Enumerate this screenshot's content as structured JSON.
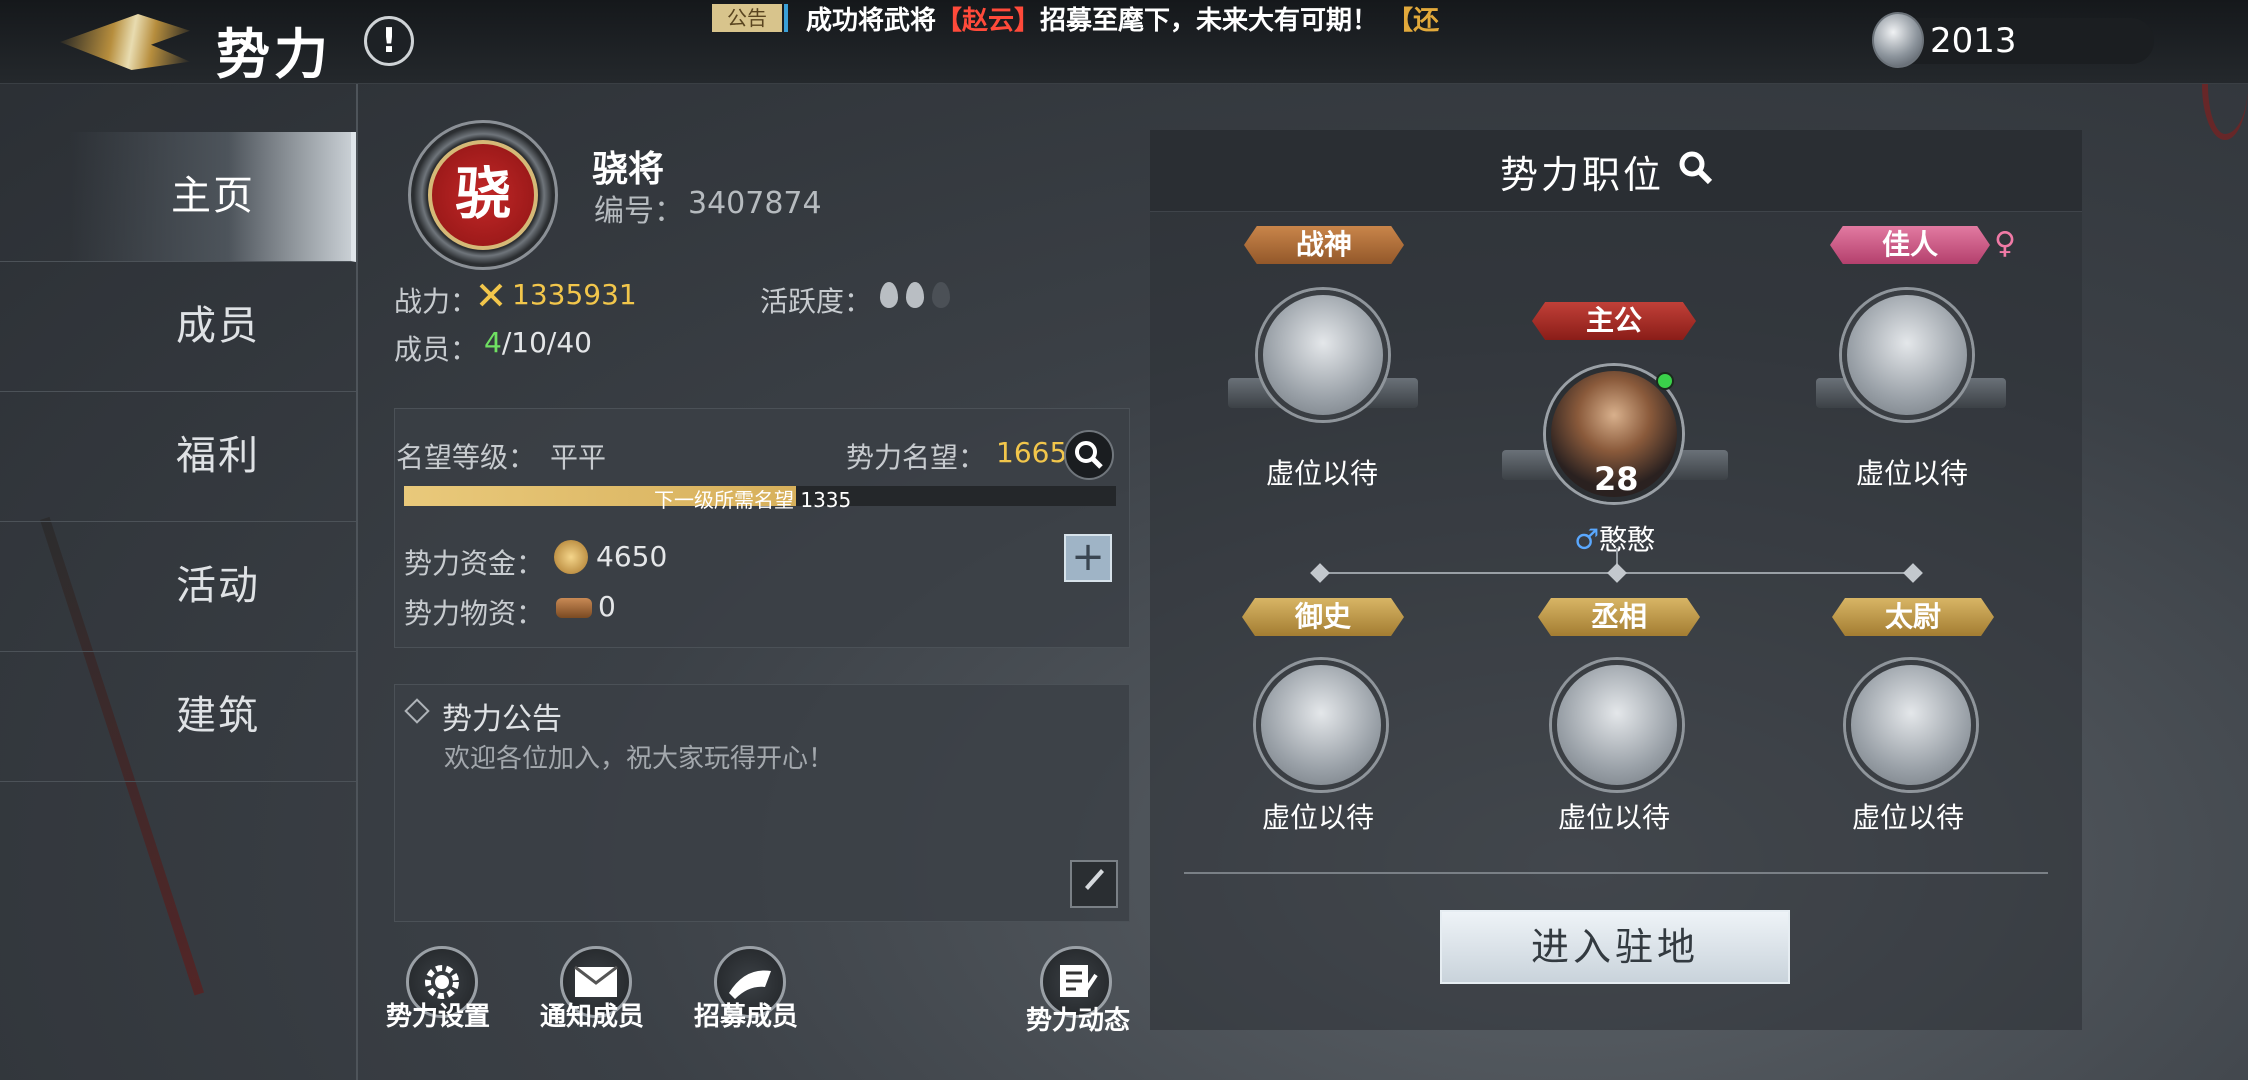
{
  "header": {
    "title": "势力",
    "info_icon": "exclamation-icon",
    "announcement_badge": "公告",
    "announcement_prefix": "成功将武将",
    "announcement_highlight": "【赵云】",
    "announcement_suffix": "招募至麾下，未来大有可期！",
    "announcement_tail": "【还",
    "currency_icon": "silver-coin-icon",
    "currency_value": "2013"
  },
  "sidebar": {
    "items": [
      {
        "label": "主页",
        "active": true
      },
      {
        "label": "成员",
        "active": false
      },
      {
        "label": "福利",
        "active": false
      },
      {
        "label": "活动",
        "active": false
      },
      {
        "label": "建筑",
        "active": false
      }
    ]
  },
  "faction": {
    "emblem_char": "骁",
    "name": "骁将",
    "id_label": "编号：",
    "id_value": "3407874",
    "power_label": "战力：",
    "power_value": "1335931",
    "activity_label": "活跃度：",
    "activity_level": 2,
    "activity_max": 3,
    "members_label": "成员：",
    "members_current": "4",
    "members_rest": "/10/40"
  },
  "prestige": {
    "level_label": "名望等级：",
    "level_value": "平平",
    "points_label": "势力名望：",
    "points_value": "1665",
    "progress_text": "下一级所需名望  1335",
    "progress_fraction": 0.55,
    "funds_label": "势力资金：",
    "funds_value": "4650",
    "supplies_label": "势力物资：",
    "supplies_value": "0"
  },
  "notice": {
    "title": "势力公告",
    "text": "欢迎各位加入，祝大家玩得开心！"
  },
  "actions": {
    "settings": "势力设置",
    "notify": "通知成员",
    "recruit": "招募成员",
    "news": "势力动态"
  },
  "positions": {
    "title": "势力职位",
    "leader": {
      "title": "主公",
      "name": "憨憨",
      "gender_symbol": "♂",
      "level": "28"
    },
    "top_left": {
      "title": "战神",
      "status": "虚位以待"
    },
    "top_right": {
      "title": "佳人",
      "status": "虚位以待",
      "gender_symbol": "♀"
    },
    "bottom": [
      {
        "title": "御史",
        "status": "虚位以待"
      },
      {
        "title": "丞相",
        "status": "虚位以待"
      },
      {
        "title": "太尉",
        "status": "虚位以待"
      }
    ],
    "enter_button": "进入驻地"
  },
  "colors": {
    "accent_gold": "#f2c64b",
    "member_green": "#6fe062",
    "announce_red": "#ff4a3a"
  }
}
